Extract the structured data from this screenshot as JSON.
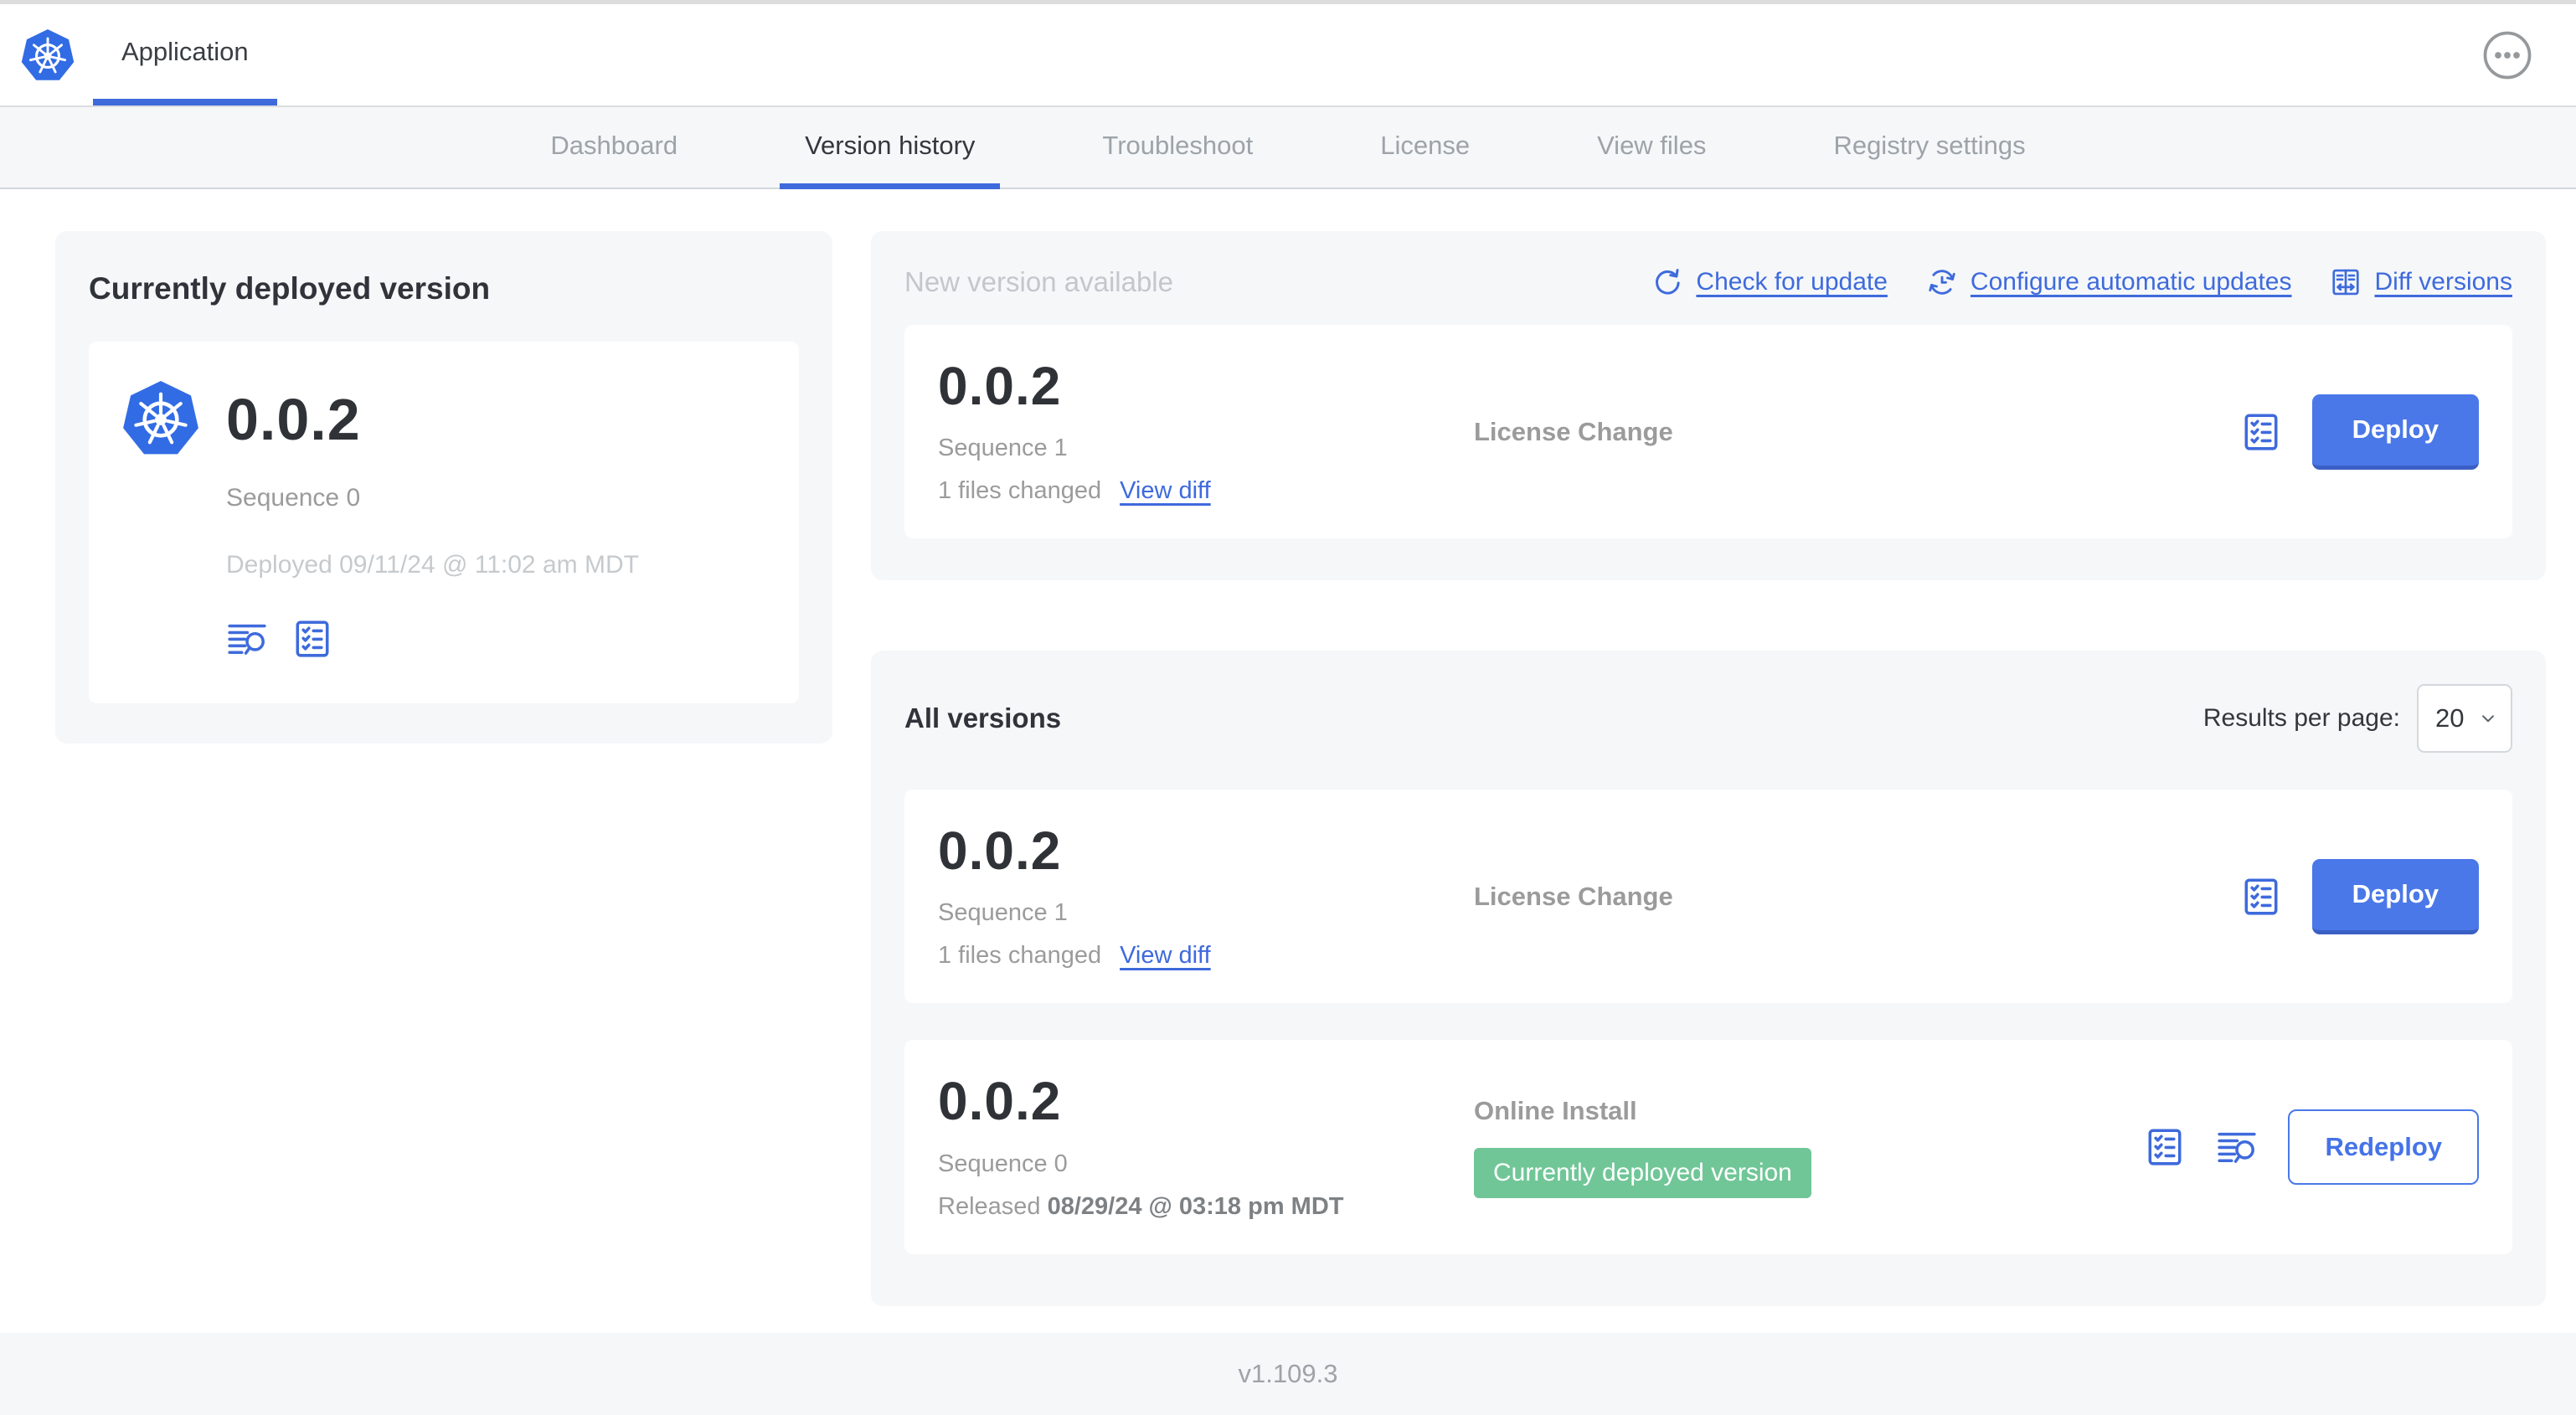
{
  "header": {
    "app_title": "Application"
  },
  "nav": {
    "tabs": [
      {
        "label": "Dashboard",
        "active": false
      },
      {
        "label": "Version history",
        "active": true
      },
      {
        "label": "Troubleshoot",
        "active": false
      },
      {
        "label": "License",
        "active": false
      },
      {
        "label": "View files",
        "active": false
      },
      {
        "label": "Registry settings",
        "active": false
      }
    ]
  },
  "current": {
    "title": "Currently deployed version",
    "version": "0.0.2",
    "sequence": "Sequence 0",
    "deployed": "Deployed 09/11/24 @ 11:02 am MDT"
  },
  "new_version": {
    "title": "New version available",
    "actions": {
      "check": "Check for update",
      "configure": "Configure automatic updates",
      "diff": "Diff versions"
    },
    "card": {
      "version": "0.0.2",
      "sequence": "Sequence 1",
      "files_changed": "1 files changed",
      "view_diff": "View diff",
      "source": "License Change",
      "action_label": "Deploy"
    }
  },
  "all_versions": {
    "title": "All versions",
    "results_per_page_label": "Results per page:",
    "results_per_page_value": "20",
    "rows": [
      {
        "version": "0.0.2",
        "sequence": "Sequence 1",
        "files_changed": "1 files changed",
        "view_diff": "View diff",
        "source": "License Change",
        "action_label": "Deploy"
      },
      {
        "version": "0.0.2",
        "sequence": "Sequence 0",
        "released_prefix": "Released ",
        "released_date": "08/29/24 @ 03:18 pm MDT",
        "source": "Online Install",
        "badge": "Currently deployed version",
        "action_label": "Redeploy"
      }
    ]
  },
  "footer": {
    "version": "v1.109.3"
  },
  "icons": {
    "app_logo": "kubernetes-wheel",
    "more_menu": "ellipsis-in-circle",
    "check_update": "refresh-arrow",
    "auto_update": "sync-clock",
    "diff": "split-table-arrows",
    "logs": "lines-magnifier",
    "checklist": "checklist-box",
    "chevron": "chevron-down"
  },
  "colors": {
    "accent_blue": "#3E6ADC",
    "button_blue": "#4A78E8",
    "logo_blue": "#326CE5",
    "badge_green": "#70C697",
    "panel_bg": "#F5F7F9",
    "text_dark": "#30343A",
    "text_gray": "#9B9B9B",
    "text_light": "#C6CACD"
  }
}
